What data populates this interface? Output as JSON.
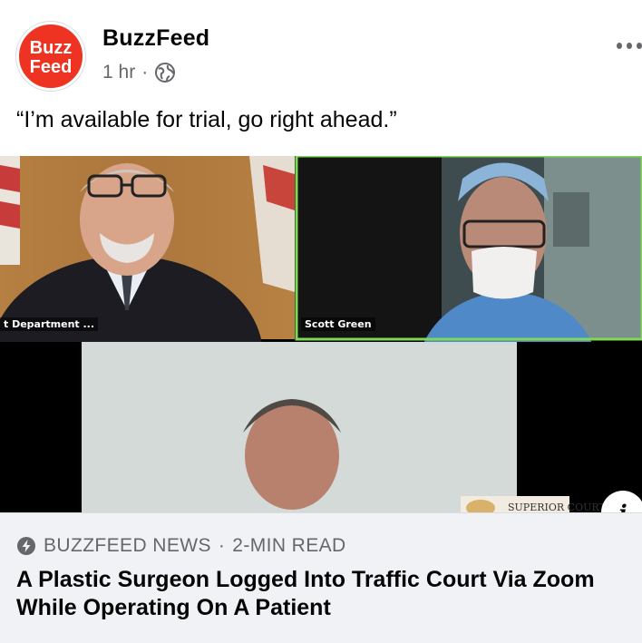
{
  "post": {
    "logo": {
      "line1": "Buzz",
      "line2": "Feed",
      "color": "#ee3322"
    },
    "page_name": "BuzzFeed",
    "time": "1 hr",
    "separator": "·",
    "audience_icon": "globe-icon",
    "menu_icon": "more-options-icon",
    "caption": "“I’m available for trial, go right ahead.”"
  },
  "video": {
    "tiles": [
      {
        "label": "t Department ..."
      },
      {
        "label": "Scott Green"
      }
    ],
    "seal_text": "SUPERIOR COURT",
    "active_speaker_color": "#7ed957",
    "info_icon": "info-icon",
    "info_label": "i"
  },
  "link_preview": {
    "source_icon": "lightning-bolt-icon",
    "source": "BUZZFEED NEWS",
    "separator": "·",
    "read_time": "2-MIN READ",
    "headline": "A Plastic Surgeon Logged Into Traffic Court Via Zoom While Operating On A Patient"
  }
}
